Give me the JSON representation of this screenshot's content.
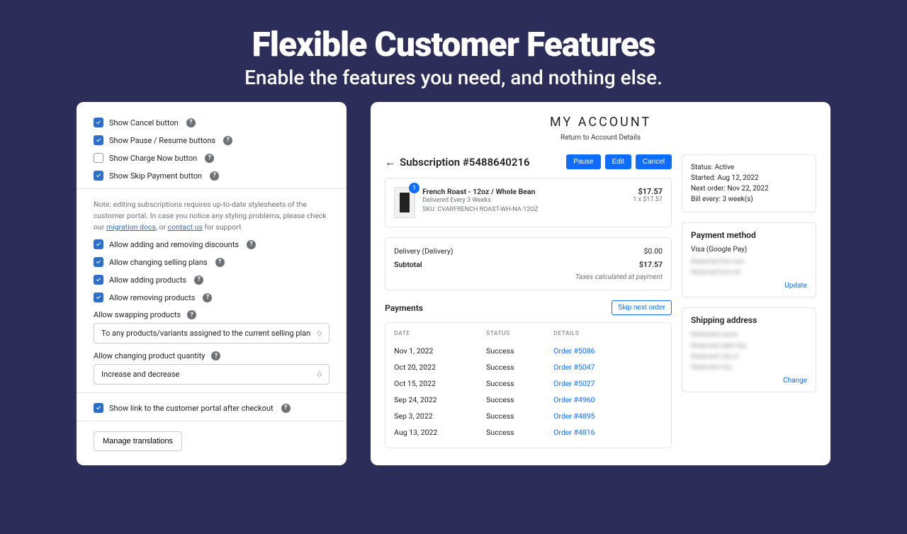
{
  "hero": {
    "title": "Flexible Customer Features",
    "subtitle": "Enable the features you need, and nothing else."
  },
  "settings": {
    "checkboxes1": [
      {
        "label": "Show Cancel button",
        "checked": true
      },
      {
        "label": "Show Pause / Resume buttons",
        "checked": true
      },
      {
        "label": "Show Charge Now button",
        "checked": false
      },
      {
        "label": "Show Skip Payment button",
        "checked": true
      }
    ],
    "note": {
      "prefix": "Note: editing subscriptions requires up-to-date stylesheets of the customer portal. In case you notice any styling problems, please check our ",
      "link1": "migration docs",
      "mid": ", or ",
      "link2": "contact us",
      "suffix": " for support"
    },
    "checkboxes2": [
      {
        "label": "Allow adding and removing discounts",
        "checked": true
      },
      {
        "label": "Allow changing selling plans",
        "checked": true
      },
      {
        "label": "Allow adding products",
        "checked": true
      },
      {
        "label": "Allow removing products",
        "checked": true
      }
    ],
    "swap_label": "Allow swapping products",
    "swap_value": "To any products/variants assigned to the current selling plan",
    "qty_label": "Allow changing product quantity",
    "qty_value": "Increase and decrease",
    "checkboxes3": [
      {
        "label": "Show link to the customer portal after checkout",
        "checked": true
      }
    ],
    "manage_btn": "Manage translations"
  },
  "account": {
    "title": "MY ACCOUNT",
    "return": "Return to Account Details",
    "sub_title": "Subscription #5488640216",
    "actions": {
      "pause": "Pause",
      "edit": "Edit",
      "cancel": "Cancel"
    },
    "product": {
      "qty": "1",
      "name": "French Roast - 12oz / Whole Bean",
      "delivered": "Delivered Every 3 Weeks",
      "sku": "SKU: CVARFRENCH ROAST-WH-NA-12OZ",
      "price": "$17.57",
      "price_sub": "1 x $17.57"
    },
    "summary": {
      "delivery_label": "Delivery (Delivery)",
      "delivery_val": "$0.00",
      "subtotal_label": "Subtotal",
      "subtotal_val": "$17.57",
      "tax_note": "Taxes calculated at payment"
    },
    "payments": {
      "title": "Payments",
      "skip_btn": "Skip next order",
      "head_date": "DATE",
      "head_status": "STATUS",
      "head_details": "DETAILS",
      "rows": [
        {
          "date": "Nov 1, 2022",
          "status": "Success",
          "details": "Order #5086"
        },
        {
          "date": "Oct 20, 2022",
          "status": "Success",
          "details": "Order #5047"
        },
        {
          "date": "Oct 15, 2022",
          "status": "Success",
          "details": "Order #5027"
        },
        {
          "date": "Sep 24, 2022",
          "status": "Success",
          "details": "Order #4960"
        },
        {
          "date": "Sep 3, 2022",
          "status": "Success",
          "details": "Order #4895"
        },
        {
          "date": "Aug 13, 2022",
          "status": "Success",
          "details": "Order #4816"
        }
      ]
    },
    "status": {
      "line1": "Status: Active",
      "line2": "Started: Aug 12, 2022",
      "line3": "Next order: Nov 22, 2022",
      "line4": "Bill every: 3 week(s)"
    },
    "payment_method": {
      "title": "Payment method",
      "card": "Visa (Google Pay)",
      "update": "Update"
    },
    "shipping": {
      "title": "Shipping address",
      "change": "Change"
    }
  }
}
